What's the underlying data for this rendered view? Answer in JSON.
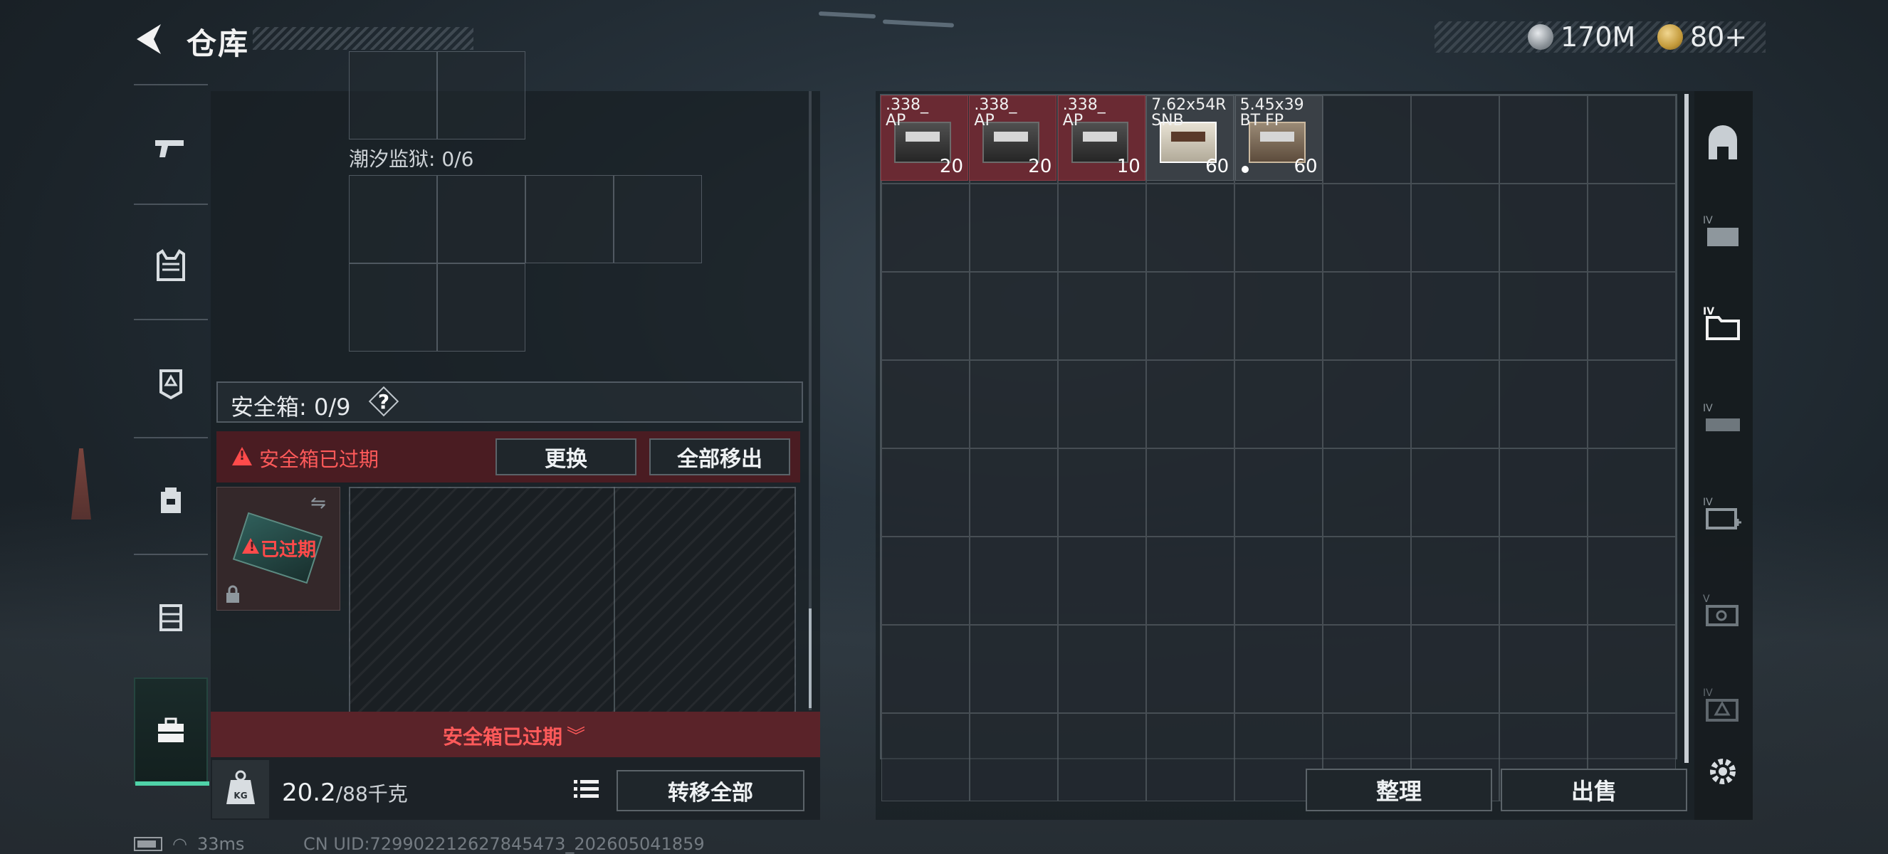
{
  "header": {
    "title": "仓库",
    "currency": [
      {
        "icon": "silver-coin-icon",
        "value": "170M"
      },
      {
        "icon": "gold-coin-icon",
        "value": "80+"
      }
    ]
  },
  "side_nav": [
    {
      "icon": "pistol-icon"
    },
    {
      "icon": "vest-icon"
    },
    {
      "icon": "armor-plate-icon"
    },
    {
      "icon": "backpack-icon"
    },
    {
      "icon": "chest-rig-icon"
    },
    {
      "icon": "briefcase-icon",
      "active": true
    }
  ],
  "left_panel": {
    "prison_label": "潮汐监狱: 0/6",
    "safe_box_label": "安全箱: 0/9",
    "help": "?",
    "expired_warning": "安全箱已过期",
    "replace_button": "更换",
    "remove_all_button": "全部移出",
    "case_status": "已过期",
    "bottom_expired": "安全箱已过期",
    "weight_current": "20.2",
    "weight_max": "/88千克",
    "transfer_all_button": "转移全部"
  },
  "stash_items": [
    {
      "name": ".338_\nAP",
      "count": "20"
    },
    {
      "name": ".338_\nAP",
      "count": "20"
    },
    {
      "name": ".338_\nAP",
      "count": "10"
    },
    {
      "name": "7.62x54R\nSNB",
      "count": "60"
    },
    {
      "name": "5.45x39\nBT FP",
      "count": "60"
    }
  ],
  "right_panel": {
    "sort_button": "整理",
    "sell_button": "出售"
  },
  "right_rail": [
    {
      "icon": "storage-icon"
    },
    {
      "icon": "weapon-case-icon",
      "tier": "IV"
    },
    {
      "icon": "folder-case-icon",
      "tier": "IV"
    },
    {
      "icon": "gun-case-icon",
      "tier": "IV"
    },
    {
      "icon": "medical-case-icon",
      "tier": "IV"
    },
    {
      "icon": "key-case-icon",
      "tier": "V"
    },
    {
      "icon": "warning-case-icon",
      "tier": "IV"
    },
    {
      "icon": "gear-icon"
    }
  ],
  "status_bar": {
    "ping": "33ms",
    "uid": "CN UID:7299022126278454​73_202605041859"
  },
  "colors": {
    "accent_green": "#4fd2a8",
    "warning_red": "#ff4b4b",
    "item_red": "#6a2a33"
  }
}
